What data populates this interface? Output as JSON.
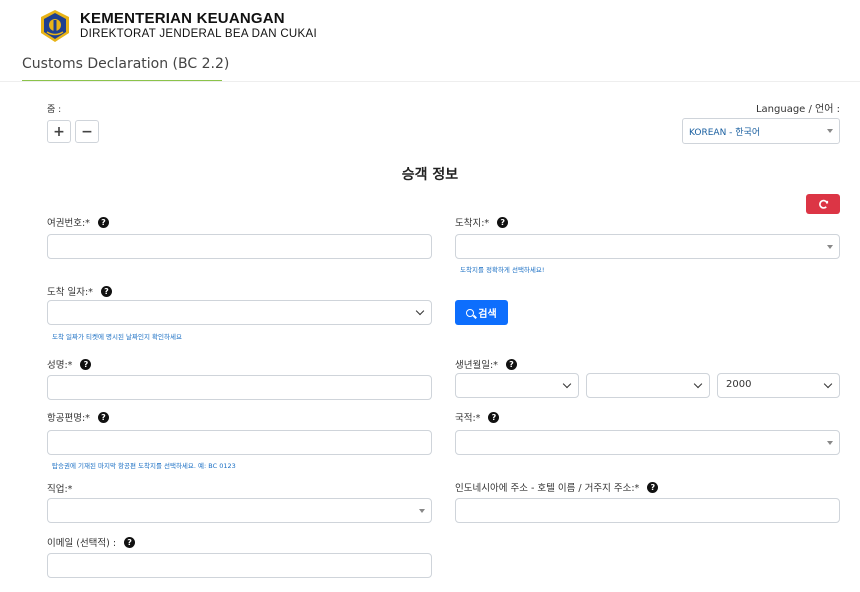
{
  "header": {
    "org_main": "KEMENTERIAN KEUANGAN",
    "org_sub": "DIREKTORAT JENDERAL BEA DAN CUKAI",
    "logo_icon": "ministry-emblem-icon"
  },
  "page_tab": "Customs Declaration (BC 2.2)",
  "colors": {
    "accent_underline": "#8bc34a",
    "primary": "#0d6efd",
    "danger": "#dc3545",
    "hint_text": "#1a6fc4"
  },
  "zoom": {
    "label": "줌 :",
    "plus": "+",
    "minus": "−"
  },
  "language": {
    "label": "Language / 언어 :",
    "selected": "KOREAN - 한국어"
  },
  "section_title": "승객 정보",
  "reset_icon": "refresh-icon",
  "fields": {
    "passport": {
      "label": "여권번호:*",
      "value": ""
    },
    "arrival_place": {
      "label": "도착지:*",
      "value": "",
      "hint": "도착지를 정확하게 선택하세요!"
    },
    "arrival_date": {
      "label": "도착 일자:*",
      "value": "",
      "hint": "도착 일짜가 티켓에 명시된 날짜인지 확인하세요"
    },
    "search_button": "검색",
    "name": {
      "label": "성명:*",
      "value": ""
    },
    "birthdate": {
      "label": "생년월일:*",
      "day": "",
      "month": "",
      "year": "2000"
    },
    "flight": {
      "label": "항공편명:*",
      "value": "",
      "hint": "탑승권에 기재된 마지막 항공편 도착지를 선택하세요. 예: BC 0123"
    },
    "nationality": {
      "label": "국적:*",
      "value": ""
    },
    "occupation": {
      "label": "직업:*",
      "value": ""
    },
    "address": {
      "label": "인도네시아에 주소 - 호텔 이름 / 거주지 주소:*",
      "value": ""
    },
    "email": {
      "label": "이메일 (선택적) :",
      "value": ""
    }
  },
  "help_symbol": "?"
}
